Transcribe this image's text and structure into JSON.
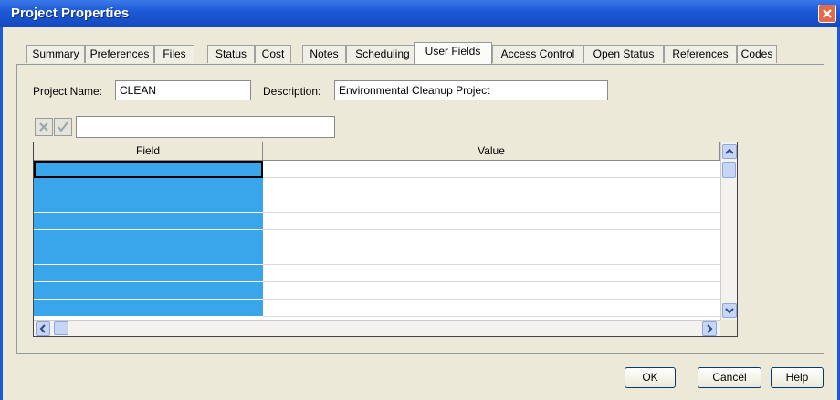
{
  "window": {
    "title": "Project Properties"
  },
  "tabs": [
    {
      "label": "Summary"
    },
    {
      "label": "Preferences"
    },
    {
      "label": "Files"
    },
    {
      "label": "Status"
    },
    {
      "label": "Cost"
    },
    {
      "label": "Notes"
    },
    {
      "label": "Scheduling"
    },
    {
      "label": "User Fields",
      "active": true
    },
    {
      "label": "Access Control"
    },
    {
      "label": "Open Status"
    },
    {
      "label": "References"
    },
    {
      "label": "Codes"
    }
  ],
  "form": {
    "project_name_label": "Project Name:",
    "project_name_value": "CLEAN",
    "description_label": "Description:",
    "description_value": "Environmental Cleanup Project"
  },
  "editbar": {
    "cancel_icon": "x-icon",
    "accept_icon": "check-icon",
    "value": ""
  },
  "grid": {
    "columns": [
      "Field",
      "Value"
    ],
    "rows": [
      {
        "field": "",
        "value": ""
      },
      {
        "field": "",
        "value": ""
      },
      {
        "field": "",
        "value": ""
      },
      {
        "field": "",
        "value": ""
      },
      {
        "field": "",
        "value": ""
      },
      {
        "field": "",
        "value": ""
      },
      {
        "field": "",
        "value": ""
      },
      {
        "field": "",
        "value": ""
      },
      {
        "field": "",
        "value": ""
      }
    ]
  },
  "buttons": {
    "ok": "OK",
    "cancel": "Cancel",
    "help": "Help"
  },
  "colors": {
    "titlebar": "#1c5ad8",
    "field_cells": "#39a6ec",
    "dialog_bg": "#ece9d8"
  }
}
